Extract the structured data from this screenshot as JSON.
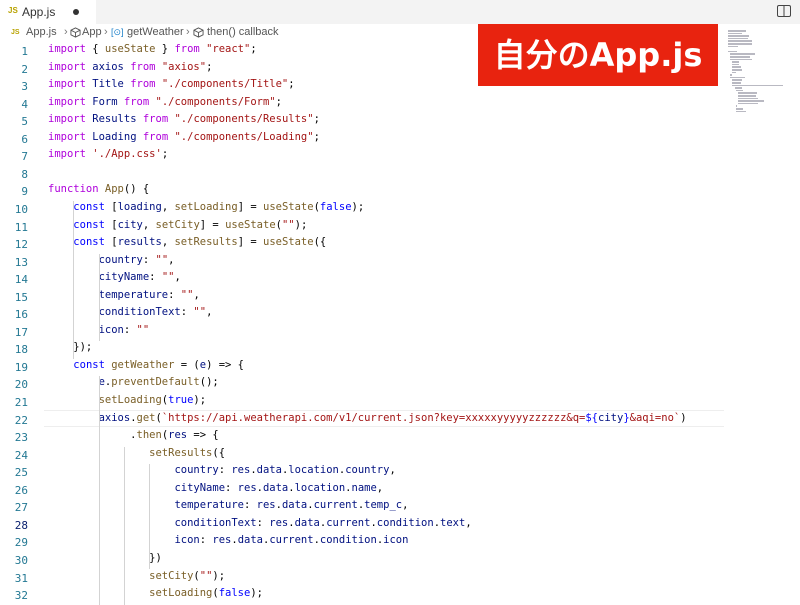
{
  "tab": {
    "icon": "JS",
    "name": "App.js"
  },
  "breadcrumb": {
    "js": "JS",
    "file": "App.js",
    "component": "App",
    "function": "getWeather",
    "callback": "then() callback"
  },
  "banner": {
    "text": "自分のApp.js"
  },
  "editor": {
    "active_line": 28,
    "line_numbers": [
      "1",
      "2",
      "3",
      "4",
      "5",
      "6",
      "7",
      "8",
      "9",
      "10",
      "11",
      "12",
      "13",
      "14",
      "15",
      "16",
      "17",
      "18",
      "19",
      "20",
      "21",
      "22",
      "23",
      "24",
      "25",
      "26",
      "27",
      "28",
      "29",
      "30",
      "31",
      "32"
    ],
    "lines": [
      "import { useState } from \"react\";",
      "import axios from \"axios\";",
      "import Title from \"./components/Title\";",
      "import Form from \"./components/Form\";",
      "import Results from \"./components/Results\";",
      "import Loading from \"./components/Loading\";",
      "import './App.css';",
      "",
      "function App() {",
      "    const [loading, setLoading] = useState(false);",
      "    const [city, setCity] = useState(\"\");",
      "    const [results, setResults] = useState({",
      "        country: \"\",",
      "        cityName: \"\",",
      "        temperature: \"\",",
      "        conditionText: \"\",",
      "        icon: \"\"",
      "    });",
      "    const getWeather = (e) => {",
      "        e.preventDefault();",
      "        setLoading(true);",
      "        axios.get(`https://api.weatherapi.com/v1/current.json?key=xxxxxyyyyyzzzzzz&q=${city}&aqi=no`)",
      "             .then(res => {",
      "                setResults({",
      "                    country: res.data.location.country,",
      "                    cityName: res.data.location.name,",
      "                    temperature: res.data.current.temp_c,",
      "                    conditionText: res.data.current.condition.text,",
      "                    icon: res.data.current.condition.icon",
      "                })",
      "                setCity(\"\");",
      "                setLoading(false);"
    ]
  },
  "colors": {
    "banner": "#e8230f",
    "keyword": "#af00db",
    "declaration": "#0000ff",
    "string": "#a31515",
    "function": "#795e26",
    "variable": "#001080",
    "line_number": "#237893"
  },
  "icons": [
    "js-file-icon",
    "cube-icon",
    "variable-icon",
    "split-editor-icon"
  ]
}
